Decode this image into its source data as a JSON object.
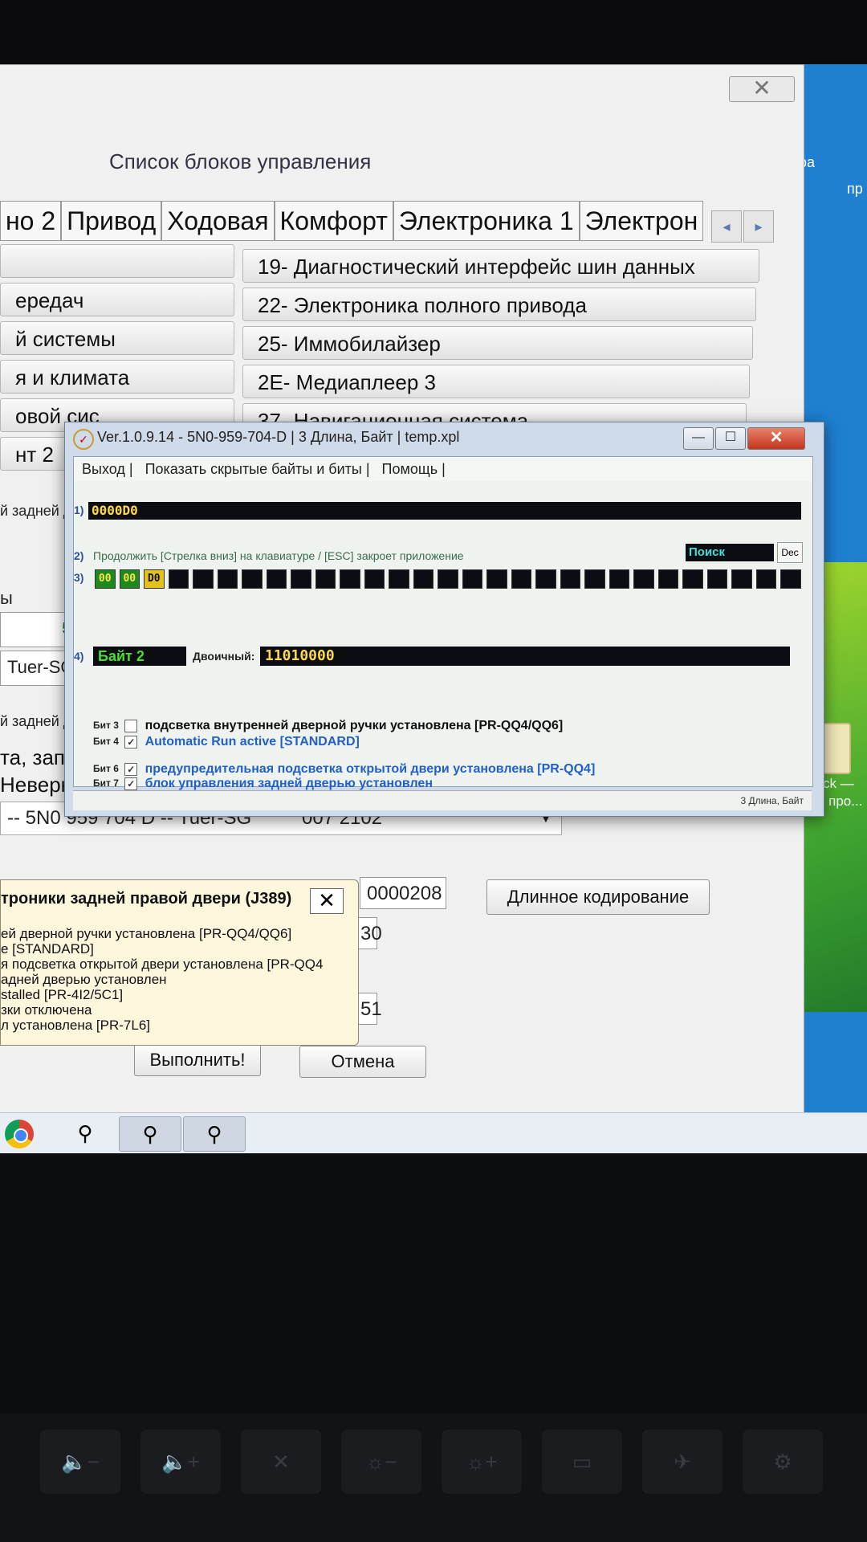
{
  "background_window": {
    "list_title": "Список блоков управления",
    "tabs": [
      "но 2",
      "Привод",
      "Ходовая",
      "Комфорт",
      "Электроника 1",
      "Электрон"
    ],
    "tab_arrows": [
      "◂",
      "▸"
    ],
    "modules": [
      "19- Диагностический интерфейс шин данных",
      "22- Электроника полного привода",
      "25- Иммобилайзер",
      "2E- Медиаплеер 3",
      "37- Навигационная система"
    ],
    "left_fragments": [
      "ередач",
      "й системы",
      "я и климата",
      "овой сис",
      "нт 2"
    ],
    "small_fragments": [
      "й задней д",
      "ы",
      "й задней дв"
    ],
    "mid_fragments": [
      "5N",
      "Tuer-SG",
      "та, запис",
      "Неверное"
    ],
    "part_line": "-- 5N0 959 704 D -- Tuer-SG",
    "version_field": "007 2102",
    "coding_field": "0000208",
    "long_coding_button": "Длинное кодирование",
    "partial_fields": [
      "30",
      "51"
    ],
    "execute_button": "Выполнить!",
    "cancel_button": "Отмена",
    "close_glyph": "✕"
  },
  "popup": {
    "title": "троники задней правой двери (J389)",
    "close_glyph": "✕",
    "lines": [
      "ей дверной ручки установлена [PR-QQ4/QQ6]",
      "e [STANDARD]",
      "я подсветка открытой двери установлена [PR-QQ4",
      "адней дверью установлен",
      "stalled [PR-4I2/5C1]",
      "зки отключена",
      "л установлена [PR-7L6]"
    ]
  },
  "desktop": {
    "fragments": [
      "ра",
      "пр"
    ],
    "icon_label": "Unlock — офф про..."
  },
  "dialog": {
    "title": "Ver.1.0.9.14 -   5N0-959-704-D | 3 Длина, Байт | temp.xpl",
    "min_glyph": "—",
    "max_glyph": "☐",
    "close_glyph": "✕",
    "menu": [
      "Выход |",
      "Показать скрытые байты и биты |",
      "Помощь |"
    ],
    "row_numbers": [
      "1)",
      "2)",
      "3)",
      "4)"
    ],
    "hex_value": "0000D0",
    "hint": "Продолжить [Стрелка вниз] на клавиатуре / [ESC] закроет приложение",
    "search_label": "Поиск",
    "dec_button": "Dec",
    "bytes": [
      "00",
      "00",
      "D0"
    ],
    "byte_label": "Байт 2",
    "binary_label": "Двоичный:",
    "binary_value": "11010000",
    "bits": [
      {
        "label": "Бит 3",
        "checked": false,
        "mark": "",
        "desc": "подсветка внутренней дверной ручки установлена [PR-QQ4/QQ6]"
      },
      {
        "label": "Бит 4",
        "checked": true,
        "mark": "✓",
        "desc": "Automatic Run active [STANDARD]"
      },
      {
        "label": "Бит 6",
        "checked": true,
        "mark": "✓",
        "desc": "предупредительная подсветка открытой двери установлена [PR-QQ4]"
      },
      {
        "label": "Бит 7",
        "checked": true,
        "mark": "✓",
        "desc": "блок управления задней дверью установлен"
      }
    ],
    "status": "3 Длина, Байт"
  },
  "taskbar": {
    "items": [
      "chrome",
      "vcp-icon",
      "vcp-icon",
      "vcp-icon"
    ],
    "glyph": "⚲"
  },
  "keyboard": {
    "keys": [
      "🔈−",
      "🔈+",
      "✕",
      "☼−",
      "☼+",
      "▭",
      "✈",
      "⚙"
    ]
  }
}
